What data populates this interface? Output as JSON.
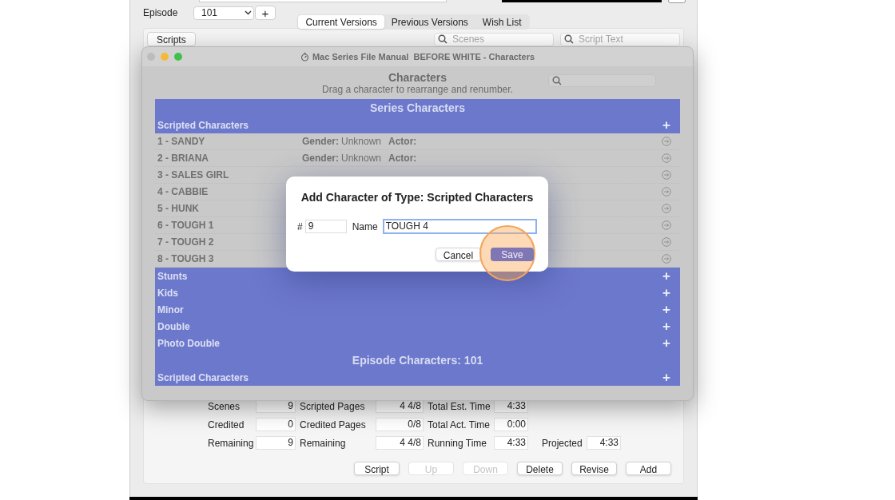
{
  "header": {
    "episode_label": "Episode",
    "episode_value": "101",
    "add_episode": "+"
  },
  "tabs": [
    {
      "label": "Current Versions",
      "selected": true
    },
    {
      "label": "Previous Versions",
      "selected": false
    },
    {
      "label": "Wish List",
      "selected": false
    }
  ],
  "scripts_button": "Scripts",
  "scenes_search": {
    "placeholder": "Scenes"
  },
  "script_text_search": {
    "placeholder": "Script Text"
  },
  "characters_window": {
    "title": "Mac Series File Manual  BEFORE WHITE - Characters",
    "heading": "Characters",
    "subtitle": "Drag a character to rearrange and renumber.",
    "rows": [
      {
        "kind": "section",
        "label": "Series Characters"
      },
      {
        "kind": "group",
        "label": "Scripted Characters",
        "add": "+"
      },
      {
        "kind": "character",
        "name": "1 - SANDY",
        "gender_label": "Gender:",
        "gender": "Unknown",
        "actor_label": "Actor:"
      },
      {
        "kind": "character",
        "name": "2 - BRIANA",
        "gender_label": "Gender:",
        "gender": "Unknown",
        "actor_label": "Actor:"
      },
      {
        "kind": "character",
        "name": "3 - SALES GIRL"
      },
      {
        "kind": "character",
        "name": "4 - CABBIE"
      },
      {
        "kind": "character",
        "name": "5 - HUNK"
      },
      {
        "kind": "character",
        "name": "6 - TOUGH 1"
      },
      {
        "kind": "character",
        "name": "7 - TOUGH 2"
      },
      {
        "kind": "character",
        "name": "8 - TOUGH 3"
      },
      {
        "kind": "group",
        "label": "Stunts",
        "add": "+"
      },
      {
        "kind": "group",
        "label": "Kids",
        "add": "+"
      },
      {
        "kind": "group",
        "label": "Minor",
        "add": "+"
      },
      {
        "kind": "group",
        "label": "Double",
        "add": "+"
      },
      {
        "kind": "group",
        "label": "Photo Double",
        "add": "+"
      },
      {
        "kind": "section",
        "label": "Episode Characters: 101"
      },
      {
        "kind": "group",
        "label": "Scripted Characters",
        "add": "+"
      }
    ]
  },
  "dialog": {
    "title": "Add Character of Type: Scripted Characters",
    "number_label": "#",
    "number": "9",
    "name_label": "Name",
    "name": "TOUGH 4",
    "buttons": [
      {
        "label": "Cancel",
        "default": false
      },
      {
        "label": "Save",
        "default": true
      }
    ],
    "click_highlight": true
  },
  "stats": [
    [
      {
        "label": "Scenes",
        "value": "9"
      },
      {
        "label": "Scripted Pages",
        "value": "4 4/8"
      },
      {
        "label": "Total Est. Time",
        "value": "4:33"
      }
    ],
    [
      {
        "label": "Credited",
        "value": "0"
      },
      {
        "label": "Credited Pages",
        "value": "0/8"
      },
      {
        "label": "Total Act. Time",
        "value": "0:00"
      }
    ],
    [
      {
        "label": "Remaining",
        "value": "9"
      },
      {
        "label": "Remaining",
        "value": "4 4/8"
      },
      {
        "label": "Running Time",
        "value": "4:33"
      },
      {
        "label": "Projected",
        "value": "4:33"
      }
    ]
  ],
  "buttons": [
    {
      "label": "Script",
      "disabled": false
    },
    {
      "label": "Up",
      "disabled": true
    },
    {
      "label": "Down",
      "disabled": true
    },
    {
      "label": "Delete",
      "disabled": false
    },
    {
      "label": "Revise",
      "disabled": false
    },
    {
      "label": "Add",
      "disabled": false
    }
  ]
}
